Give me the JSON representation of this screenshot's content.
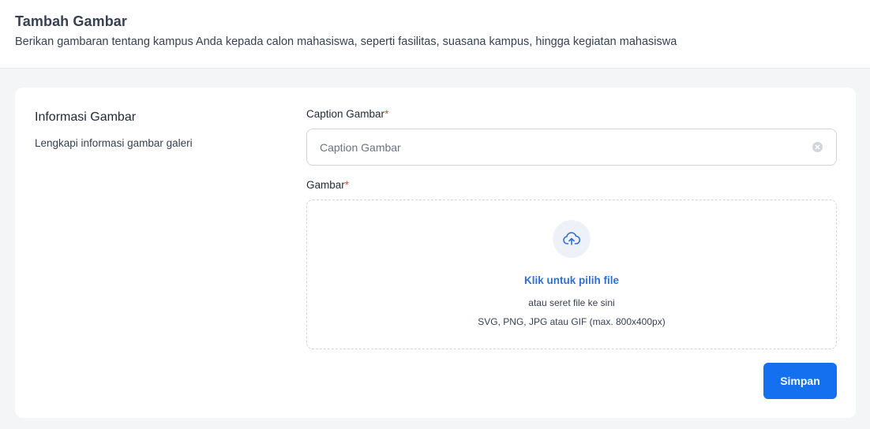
{
  "header": {
    "title": "Tambah Gambar",
    "subtitle": "Berikan gambaran tentang kampus Anda kepada calon mahasiswa, seperti fasilitas, suasana kampus, hingga kegiatan mahasiswa"
  },
  "section": {
    "title": "Informasi Gambar",
    "description": "Lengkapi informasi gambar galeri"
  },
  "form": {
    "caption_label": "Caption Gambar",
    "caption_placeholder": "Caption Gambar",
    "caption_value": "",
    "image_label": "Gambar",
    "required_mark": "*",
    "upload_link": "Klik untuk pilih file",
    "upload_hint": "atau seret file ke sini",
    "upload_formats": "SVG, PNG, JPG atau GIF (max. 800x400px)",
    "upload_icon": "cloud-upload-icon",
    "clear_icon": "clear-circle-icon"
  },
  "actions": {
    "save_label": "Simpan"
  },
  "colors": {
    "primary": "#1570ef",
    "link": "#2f6fd6",
    "required": "#ef4444"
  }
}
